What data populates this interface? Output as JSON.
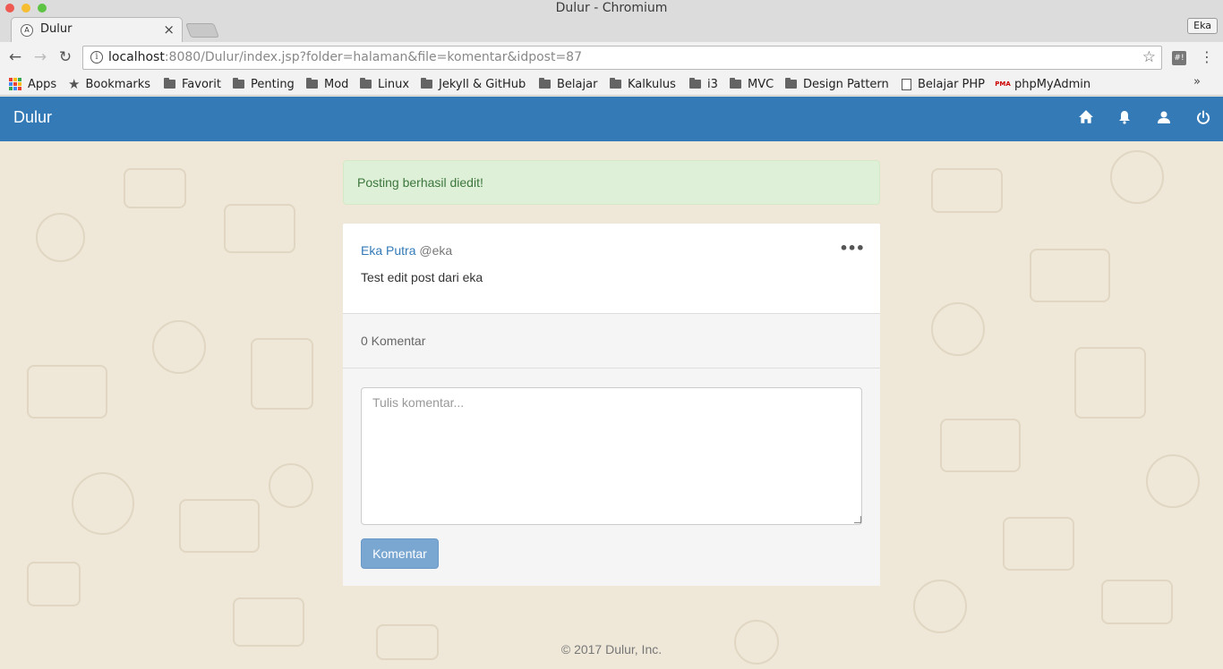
{
  "window": {
    "title": "Dulur - Chromium",
    "profile": "Eka"
  },
  "tab": {
    "title": "Dulur",
    "favicon": "A"
  },
  "address_bar": {
    "host": "localhost",
    "rest": ":8080/Dulur/index.jsp?folder=halaman&file=komentar&idpost=87"
  },
  "bookmarks": {
    "apps": "Apps",
    "bookmarks": "Bookmarks",
    "favorit": "Favorit",
    "penting": "Penting",
    "mod": "Mod",
    "linux": "Linux",
    "jekyll": "Jekyll & GitHub",
    "belajar": "Belajar",
    "kalkulus": "Kalkulus",
    "i3": "i3",
    "mvc": "MVC",
    "design_pattern": "Design Pattern",
    "belajar_php": "Belajar PHP",
    "phpmyadmin": "phpMyAdmin",
    "more": "»"
  },
  "navbar": {
    "brand": "Dulur"
  },
  "alert": {
    "message": "Posting berhasil diedit!"
  },
  "post": {
    "author": "Eka Putra",
    "handle": "@eka",
    "body": "Test edit post dari eka",
    "more": "•••"
  },
  "comments": {
    "count_label": "0 Komentar",
    "placeholder": "Tulis komentar...",
    "submit_label": "Komentar"
  },
  "footer": {
    "text": "© 2017 Dulur, Inc."
  },
  "colors": {
    "primary": "#337ab7",
    "alert_bg": "#dff0d8",
    "alert_text": "#3c763d",
    "page_bg": "#efe8d9"
  }
}
